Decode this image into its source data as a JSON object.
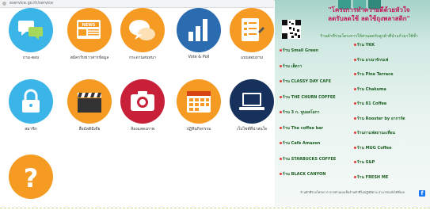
{
  "browser": {
    "url": "eservice.go.th/service"
  },
  "tiles": [
    {
      "label": "ถาม-ตอบ",
      "icon": "chat-bubbles-icon",
      "color": "#3bb5e8"
    },
    {
      "label": "สมัครรับข่าวสารข้อมูล",
      "icon": "news-icon",
      "color": "#f59a23"
    },
    {
      "label": "กระดานสนทนา",
      "icon": "speech-bubbles-icon",
      "color": "#f59a23"
    },
    {
      "label": "Vote & Poll",
      "icon": "bar-chart-icon",
      "color": "#2b6bb0"
    },
    {
      "label": "แบบสอบถาม",
      "icon": "form-pencil-icon",
      "color": "#f59a23"
    },
    {
      "label": "สมาชิก",
      "icon": "lock-icon",
      "color": "#3bb5e8"
    },
    {
      "label": "สื่อมัลติมีเดีย",
      "icon": "clapperboard-icon",
      "color": "#f59a23"
    },
    {
      "label": "ห้องแสดงภาพ",
      "icon": "camera-icon",
      "color": "#c9203a"
    },
    {
      "label": "ปฏิทินกิจกรรม",
      "icon": "calendar-icon",
      "color": "#f59a23"
    },
    {
      "label": "เว็บไซต์ที่น่าสนใจ",
      "icon": "laptop-icon",
      "color": "#16325c"
    },
    {
      "label": "",
      "icon": "question-mark-icon",
      "color": "#f59a23"
    }
  ],
  "poster": {
    "title_line1": "\"โครงการทำความดีด้วยหัวใจ",
    "title_line2": "ลดรับลดใช้ ลดใช้ถุงพลาสติก\"",
    "subtitle": "ร้านค้าที่ร่วมโครงการให้ส่วนลดกับลูกค้าที่นำแก้วมาใช้ซ้ำ",
    "items_left": [
      "ร้าน Small Green",
      "ร้าน เฮ็ดวา",
      "ร้าน CLASSY DAY CAFE",
      "ร้าน THE CHURN COFFEE",
      "ร้าน 3 ก. ทูบอลโยกา",
      "ร้าน The coffee bar",
      "ร้าน Café Amazon",
      "ร้าน STARBUCKS COFFEE",
      "ร้าน BLACK CANYON"
    ],
    "items_right": [
      "ร้าน YKK",
      "ร้าน อาณาจักรแฟ",
      "ร้าน Pine Terrace",
      "ร้าน Chakuma",
      "ร้าน 81 Coffee",
      "ร้าน Rooster by อาการัด",
      "ร้านกาแฟสถานะเทื่อน",
      "ร้าน MUG Coffee",
      "ร้าน S&P",
      "ร้าน FRESH ME"
    ],
    "footer_note": "ร้านค้าที่ร่วมโครงการ หากท่านพบเห็นร้านค้าที่ไม่ปฏิบัติตาม สามารถแจ้งได้ที่เพจ",
    "fb_letter": "f"
  }
}
